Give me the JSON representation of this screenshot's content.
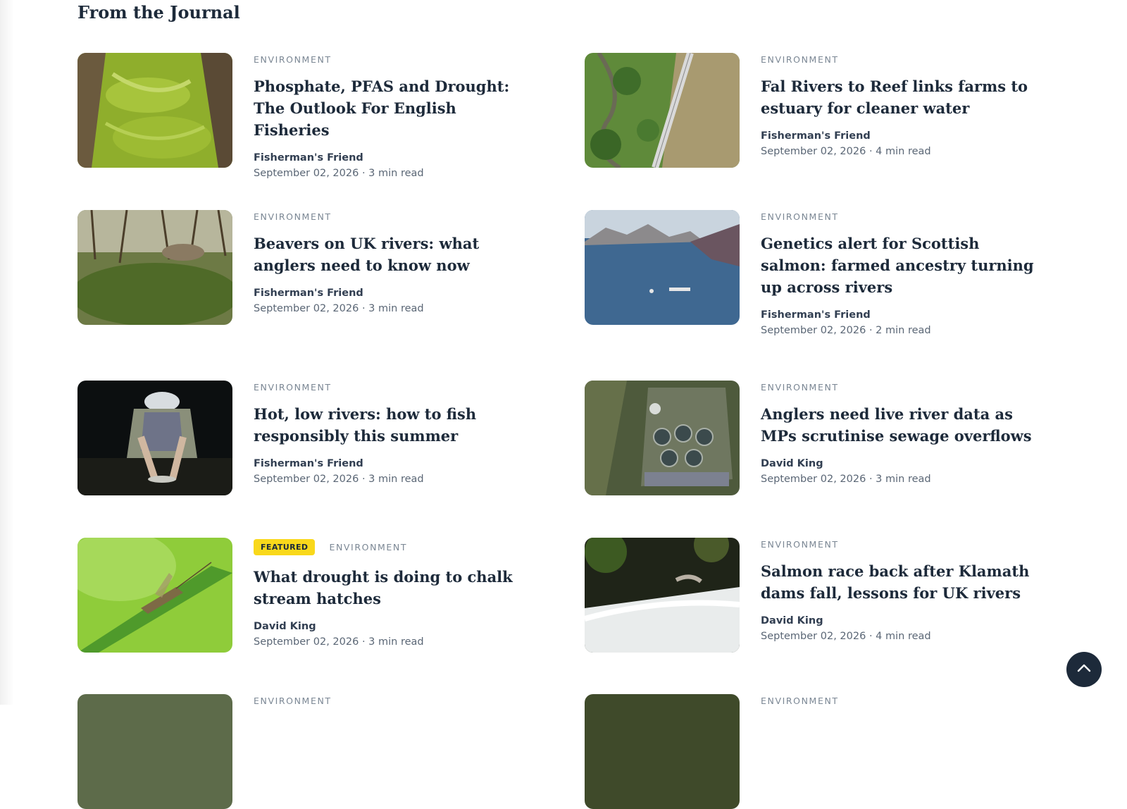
{
  "section": {
    "title": "From the Journal"
  },
  "articles": [
    {
      "category": "ENVIRONMENT",
      "title": "Phosphate, PFAS and Drought: The Outlook For English Fisheries",
      "author": "Fisherman's Friend",
      "date": "September 02, 2026",
      "read_time": "3 min read"
    },
    {
      "category": "ENVIRONMENT",
      "title": "Fal Rivers to Reef links farms to estuary for cleaner water",
      "author": "Fisherman's Friend",
      "date": "September 02, 2026",
      "read_time": "4 min read"
    },
    {
      "category": "ENVIRONMENT",
      "title": "Beavers on UK rivers: what anglers need to know now",
      "author": "Fisherman's Friend",
      "date": "September 02, 2026",
      "read_time": "3 min read"
    },
    {
      "category": "ENVIRONMENT",
      "title": "Genetics alert for Scottish salmon: farmed ancestry turning up across rivers",
      "author": "Fisherman's Friend",
      "date": "September 02, 2026",
      "read_time": "2 min read"
    },
    {
      "category": "ENVIRONMENT",
      "title": "Hot, low rivers: how to fish responsibly this summer",
      "author": "Fisherman's Friend",
      "date": "September 02, 2026",
      "read_time": "3 min read"
    },
    {
      "category": "ENVIRONMENT",
      "title": "Anglers need live river data as MPs scrutinise sewage overflows",
      "author": "David King",
      "date": "September 02, 2026",
      "read_time": "3 min read"
    },
    {
      "badge": "FEATURED",
      "category": "ENVIRONMENT",
      "title": "What drought is doing to chalk stream hatches",
      "author": "David King",
      "date": "September 02, 2026",
      "read_time": "3 min read"
    },
    {
      "category": "ENVIRONMENT",
      "title": "Salmon race back after Klamath dams fall, lessons for UK rivers",
      "author": "David King",
      "date": "September 02, 2026",
      "read_time": "4 min read"
    },
    {
      "category": "ENVIRONMENT"
    },
    {
      "category": "ENVIRONMENT"
    }
  ],
  "meta_separator": "·",
  "colors": {
    "title": "#1d2a3a",
    "category": "#7b8794",
    "badge": "#f9d81b",
    "back_to_top": "#1d2a3a"
  },
  "back_to_top": {
    "icon": "chevron-up-icon"
  }
}
